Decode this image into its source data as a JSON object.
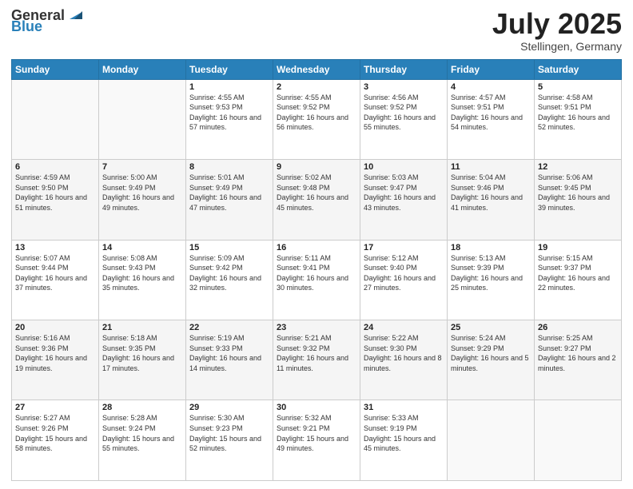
{
  "header": {
    "logo_general": "General",
    "logo_blue": "Blue",
    "title": "July 2025",
    "subtitle": "Stellingen, Germany"
  },
  "days_of_week": [
    "Sunday",
    "Monday",
    "Tuesday",
    "Wednesday",
    "Thursday",
    "Friday",
    "Saturday"
  ],
  "weeks": [
    [
      {
        "day": "",
        "info": ""
      },
      {
        "day": "",
        "info": ""
      },
      {
        "day": "1",
        "info": "Sunrise: 4:55 AM\nSunset: 9:53 PM\nDaylight: 16 hours and 57 minutes."
      },
      {
        "day": "2",
        "info": "Sunrise: 4:55 AM\nSunset: 9:52 PM\nDaylight: 16 hours and 56 minutes."
      },
      {
        "day": "3",
        "info": "Sunrise: 4:56 AM\nSunset: 9:52 PM\nDaylight: 16 hours and 55 minutes."
      },
      {
        "day": "4",
        "info": "Sunrise: 4:57 AM\nSunset: 9:51 PM\nDaylight: 16 hours and 54 minutes."
      },
      {
        "day": "5",
        "info": "Sunrise: 4:58 AM\nSunset: 9:51 PM\nDaylight: 16 hours and 52 minutes."
      }
    ],
    [
      {
        "day": "6",
        "info": "Sunrise: 4:59 AM\nSunset: 9:50 PM\nDaylight: 16 hours and 51 minutes."
      },
      {
        "day": "7",
        "info": "Sunrise: 5:00 AM\nSunset: 9:49 PM\nDaylight: 16 hours and 49 minutes."
      },
      {
        "day": "8",
        "info": "Sunrise: 5:01 AM\nSunset: 9:49 PM\nDaylight: 16 hours and 47 minutes."
      },
      {
        "day": "9",
        "info": "Sunrise: 5:02 AM\nSunset: 9:48 PM\nDaylight: 16 hours and 45 minutes."
      },
      {
        "day": "10",
        "info": "Sunrise: 5:03 AM\nSunset: 9:47 PM\nDaylight: 16 hours and 43 minutes."
      },
      {
        "day": "11",
        "info": "Sunrise: 5:04 AM\nSunset: 9:46 PM\nDaylight: 16 hours and 41 minutes."
      },
      {
        "day": "12",
        "info": "Sunrise: 5:06 AM\nSunset: 9:45 PM\nDaylight: 16 hours and 39 minutes."
      }
    ],
    [
      {
        "day": "13",
        "info": "Sunrise: 5:07 AM\nSunset: 9:44 PM\nDaylight: 16 hours and 37 minutes."
      },
      {
        "day": "14",
        "info": "Sunrise: 5:08 AM\nSunset: 9:43 PM\nDaylight: 16 hours and 35 minutes."
      },
      {
        "day": "15",
        "info": "Sunrise: 5:09 AM\nSunset: 9:42 PM\nDaylight: 16 hours and 32 minutes."
      },
      {
        "day": "16",
        "info": "Sunrise: 5:11 AM\nSunset: 9:41 PM\nDaylight: 16 hours and 30 minutes."
      },
      {
        "day": "17",
        "info": "Sunrise: 5:12 AM\nSunset: 9:40 PM\nDaylight: 16 hours and 27 minutes."
      },
      {
        "day": "18",
        "info": "Sunrise: 5:13 AM\nSunset: 9:39 PM\nDaylight: 16 hours and 25 minutes."
      },
      {
        "day": "19",
        "info": "Sunrise: 5:15 AM\nSunset: 9:37 PM\nDaylight: 16 hours and 22 minutes."
      }
    ],
    [
      {
        "day": "20",
        "info": "Sunrise: 5:16 AM\nSunset: 9:36 PM\nDaylight: 16 hours and 19 minutes."
      },
      {
        "day": "21",
        "info": "Sunrise: 5:18 AM\nSunset: 9:35 PM\nDaylight: 16 hours and 17 minutes."
      },
      {
        "day": "22",
        "info": "Sunrise: 5:19 AM\nSunset: 9:33 PM\nDaylight: 16 hours and 14 minutes."
      },
      {
        "day": "23",
        "info": "Sunrise: 5:21 AM\nSunset: 9:32 PM\nDaylight: 16 hours and 11 minutes."
      },
      {
        "day": "24",
        "info": "Sunrise: 5:22 AM\nSunset: 9:30 PM\nDaylight: 16 hours and 8 minutes."
      },
      {
        "day": "25",
        "info": "Sunrise: 5:24 AM\nSunset: 9:29 PM\nDaylight: 16 hours and 5 minutes."
      },
      {
        "day": "26",
        "info": "Sunrise: 5:25 AM\nSunset: 9:27 PM\nDaylight: 16 hours and 2 minutes."
      }
    ],
    [
      {
        "day": "27",
        "info": "Sunrise: 5:27 AM\nSunset: 9:26 PM\nDaylight: 15 hours and 58 minutes."
      },
      {
        "day": "28",
        "info": "Sunrise: 5:28 AM\nSunset: 9:24 PM\nDaylight: 15 hours and 55 minutes."
      },
      {
        "day": "29",
        "info": "Sunrise: 5:30 AM\nSunset: 9:23 PM\nDaylight: 15 hours and 52 minutes."
      },
      {
        "day": "30",
        "info": "Sunrise: 5:32 AM\nSunset: 9:21 PM\nDaylight: 15 hours and 49 minutes."
      },
      {
        "day": "31",
        "info": "Sunrise: 5:33 AM\nSunset: 9:19 PM\nDaylight: 15 hours and 45 minutes."
      },
      {
        "day": "",
        "info": ""
      },
      {
        "day": "",
        "info": ""
      }
    ]
  ]
}
